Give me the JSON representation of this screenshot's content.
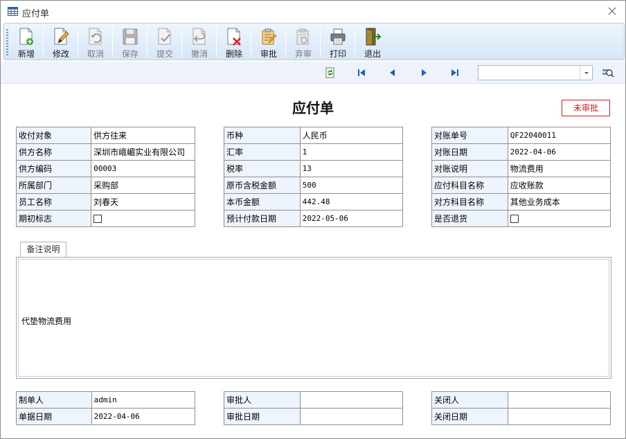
{
  "window": {
    "title": "应付单"
  },
  "toolbar": [
    {
      "label": "新增",
      "icon": "new-doc-icon",
      "disabled": false
    },
    {
      "label": "修改",
      "icon": "edit-doc-icon",
      "disabled": false
    },
    {
      "label": "取消",
      "icon": "undo-icon",
      "disabled": true
    },
    {
      "label": "保存",
      "icon": "save-icon",
      "disabled": true
    },
    {
      "label": "提交",
      "icon": "submit-icon",
      "disabled": true
    },
    {
      "label": "撤消",
      "icon": "revoke-icon",
      "disabled": true
    },
    {
      "label": "删除",
      "icon": "delete-icon",
      "disabled": false
    },
    {
      "label": "审批",
      "icon": "approve-icon",
      "disabled": false
    },
    {
      "label": "弃审",
      "icon": "unapprove-icon",
      "disabled": true
    },
    {
      "label": "打印",
      "icon": "print-icon",
      "disabled": false
    },
    {
      "label": "退出",
      "icon": "exit-icon",
      "disabled": false
    }
  ],
  "nav": {
    "combo_value": ""
  },
  "doc": {
    "title": "应付单",
    "status": "未审批"
  },
  "form_left": [
    {
      "label": "收付对象",
      "value": "供方往来"
    },
    {
      "label": "供方名称",
      "value": "深圳市峨嵋实业有限公司"
    },
    {
      "label": "供方编码",
      "value": "00003"
    },
    {
      "label": "所属部门",
      "value": "采购部"
    },
    {
      "label": "员工名称",
      "value": "刘春天"
    },
    {
      "label": "期初标志",
      "value": ""
    }
  ],
  "form_mid": [
    {
      "label": "币种",
      "value": "人民币"
    },
    {
      "label": "汇率",
      "value": "1"
    },
    {
      "label": "税率",
      "value": "13"
    },
    {
      "label": "原币含税金额",
      "value": "500"
    },
    {
      "label": "本币金额",
      "value": "442.48"
    },
    {
      "label": "预计付款日期",
      "value": "2022-05-06"
    }
  ],
  "form_right": [
    {
      "label": "对账单号",
      "value": "QF22040011"
    },
    {
      "label": "对账日期",
      "value": "2022-04-06"
    },
    {
      "label": "对账说明",
      "value": "物流费用"
    },
    {
      "label": "应付科目名称",
      "value": "应收账款"
    },
    {
      "label": "对方科目名称",
      "value": "其他业务成本"
    },
    {
      "label": "是否退货",
      "value": ""
    }
  ],
  "remark": {
    "tab_label": "备注说明",
    "text": "代垫物流费用"
  },
  "footer_left": [
    {
      "label": "制单人",
      "value": "admin"
    },
    {
      "label": "单据日期",
      "value": "2022-04-06"
    }
  ],
  "footer_mid": [
    {
      "label": "审批人",
      "value": ""
    },
    {
      "label": "审批日期",
      "value": ""
    }
  ],
  "footer_right": [
    {
      "label": "关闭人",
      "value": ""
    },
    {
      "label": "关闭日期",
      "value": ""
    }
  ]
}
